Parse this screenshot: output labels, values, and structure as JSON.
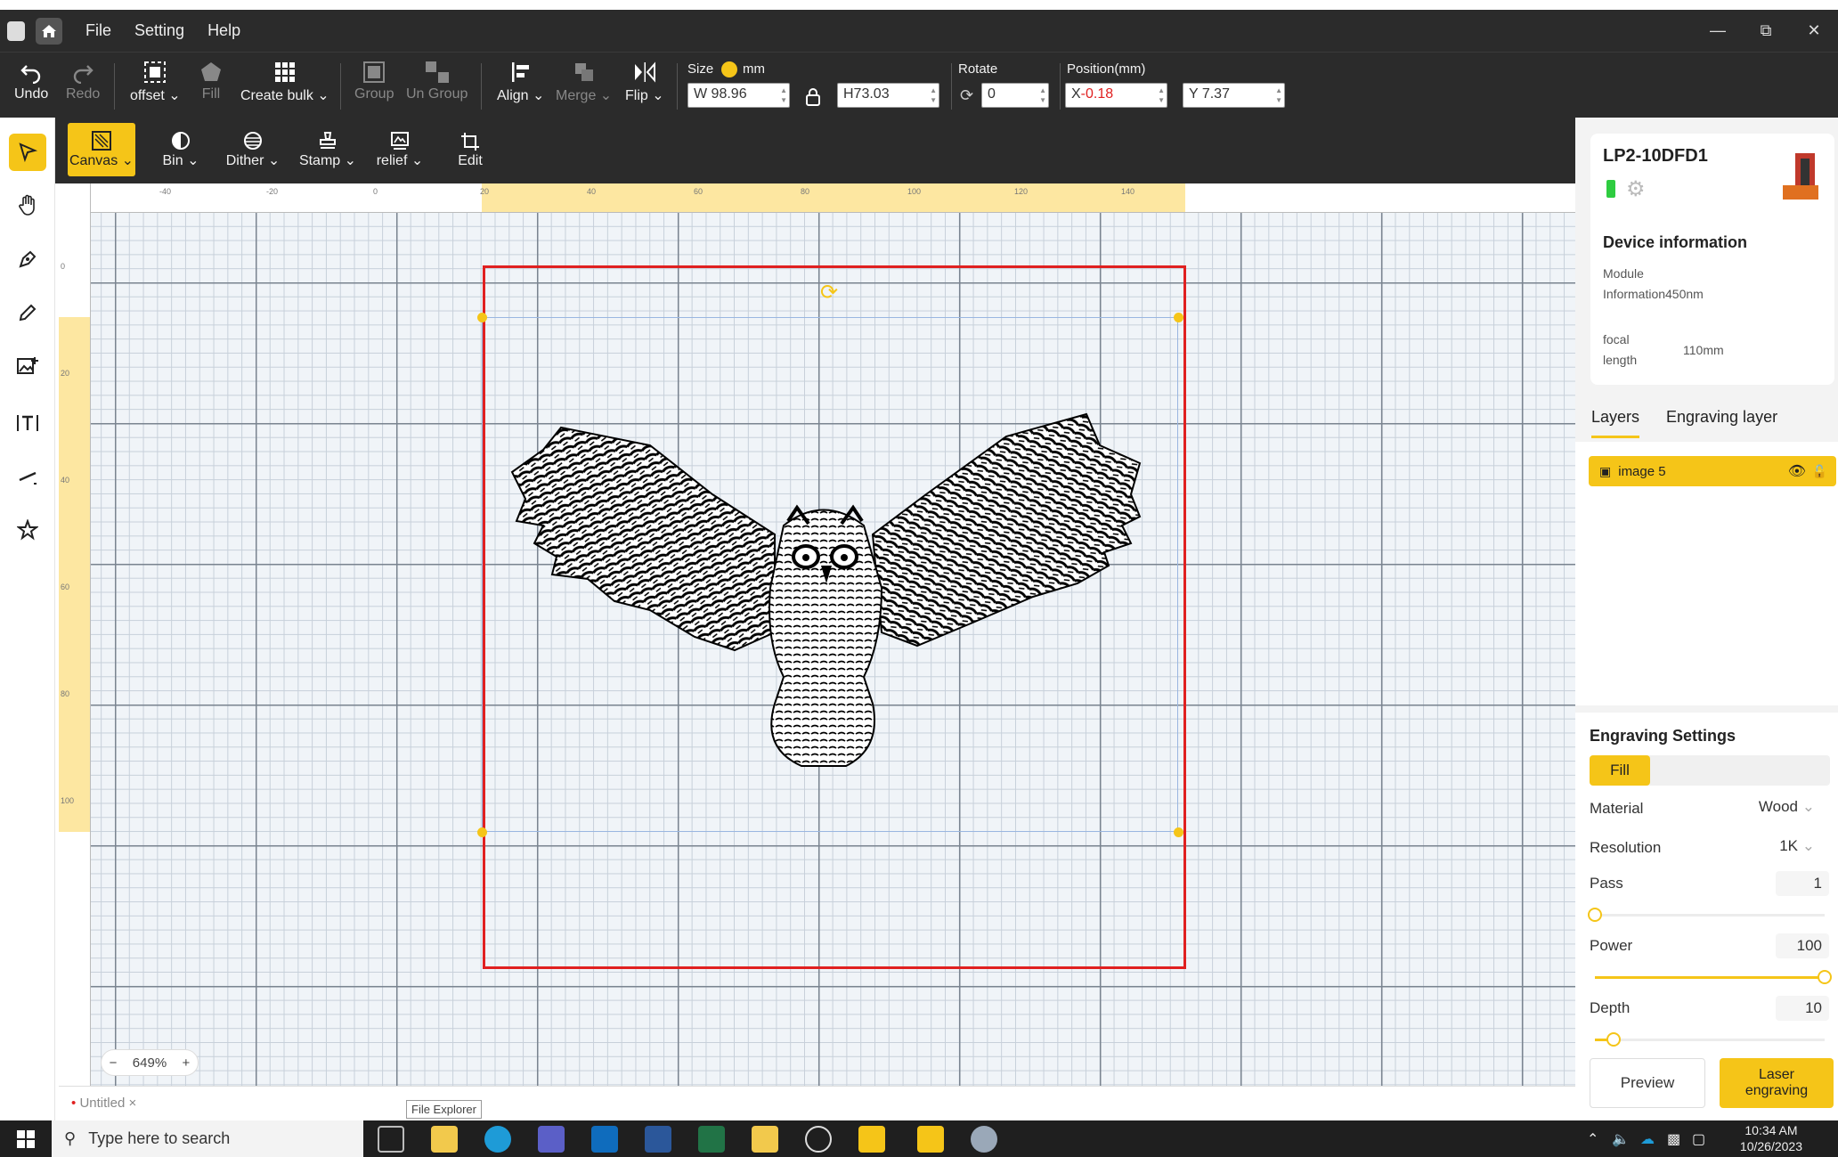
{
  "menu": {
    "file": "File",
    "setting": "Setting",
    "help": "Help"
  },
  "toolbar": {
    "undo": "Undo",
    "redo": "Redo",
    "offset": "offset",
    "fill": "Fill",
    "create_bulk": "Create bulk",
    "group": "Group",
    "ungroup": "Un Group",
    "align": "Align",
    "merge": "Merge",
    "flip": "Flip",
    "size_label": "Size",
    "unit": "mm",
    "width": "W 98.96",
    "height": "H73.03",
    "rotate_label": "Rotate",
    "rotate_value": "0",
    "position_label": "Position(mm)",
    "x_prefix": "X",
    "x_value": "-0.18",
    "y_value": "Y 7.37"
  },
  "secondary": {
    "canvas": "Canvas",
    "bin": "Bin",
    "dither": "Dither",
    "stamp": "Stamp",
    "relief": "relief",
    "edit": "Edit"
  },
  "ruler": {
    "h_ticks": [
      "-40",
      "-20",
      "0",
      "20",
      "40",
      "60",
      "80",
      "100",
      "120",
      "140"
    ],
    "v_ticks": [
      "0",
      "20",
      "40",
      "60",
      "80",
      "100"
    ]
  },
  "zoom": {
    "minus": "−",
    "value": "649%",
    "plus": "+"
  },
  "doc_tab": {
    "marker": "•",
    "name": "Untitled",
    "close": "×"
  },
  "tooltip": "File Explorer",
  "device": {
    "name": "LP2-10DFD1",
    "section": "Device information",
    "module_label": "Module Information",
    "module_value": "450nm",
    "focal_label": "focal length",
    "focal_value": "110mm"
  },
  "tabs": {
    "layers": "Layers",
    "engraving_layer": "Engraving layer"
  },
  "layer": {
    "name": "image 5"
  },
  "engraving": {
    "title": "Engraving Settings",
    "fill_tab": "Fill",
    "material_label": "Material",
    "material_value": "Wood",
    "resolution_label": "Resolution",
    "resolution_value": "1K",
    "pass_label": "Pass",
    "pass_value": "1",
    "power_label": "Power",
    "power_value": "100",
    "depth_label": "Depth",
    "depth_value": "10",
    "pass_level": 0.0,
    "power_level": 1.0,
    "depth_level": 0.08,
    "preview": "Preview",
    "laser": "Laser engraving"
  },
  "taskbar": {
    "search_placeholder": "Type here to search",
    "time": "10:34 AM",
    "date": "10/26/2023"
  },
  "colors": {
    "accent": "#f5c518",
    "artboard": "#e02020",
    "position_x": "#e02020"
  }
}
